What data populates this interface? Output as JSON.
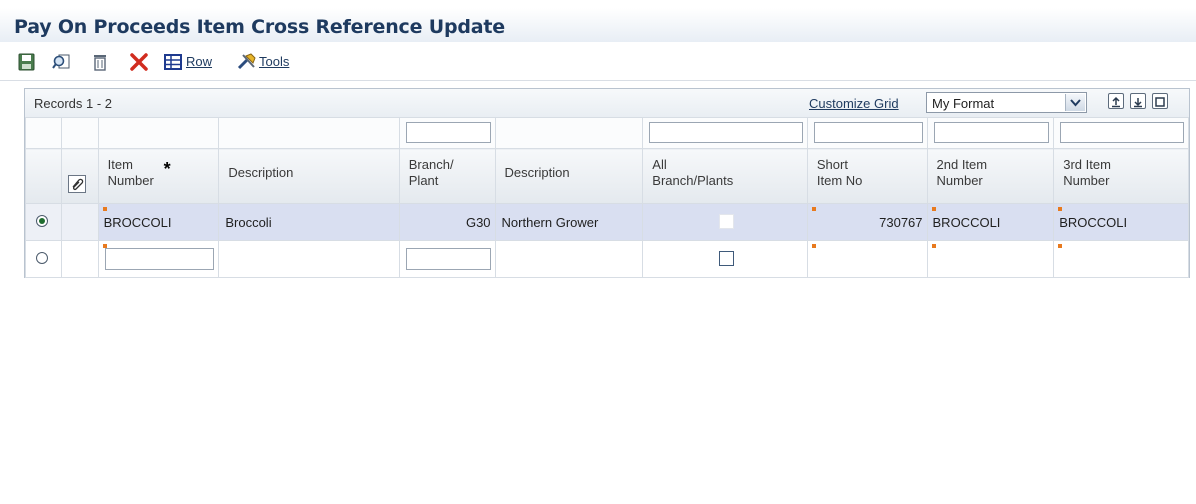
{
  "page": {
    "title": "Pay On Proceeds Item Cross Reference Update"
  },
  "toolbar": {
    "save_icon": "save-icon",
    "inquire_icon": "find-icon",
    "delete_icon": "delete-icon",
    "cancel_icon": "close-icon",
    "row_label": "Row",
    "tools_label": "Tools"
  },
  "grid": {
    "records_label": "Records 1 - 2",
    "customize_label": "Customize Grid",
    "format_value": "My Format",
    "columns": [
      {
        "label": "Item\nNumber",
        "required": "*"
      },
      {
        "label": "Description"
      },
      {
        "label": "Branch/\nPlant"
      },
      {
        "label": "Description"
      },
      {
        "label": "All\nBranch/Plants"
      },
      {
        "label": "Short\nItem No"
      },
      {
        "label": "2nd Item\nNumber"
      },
      {
        "label": "3rd Item\nNumber"
      }
    ],
    "rows": [
      {
        "selected": true,
        "item_number": "BROCCOLI",
        "description": "Broccoli",
        "branch_plant": "G30",
        "branch_description": "Northern Grower",
        "all_branch_plants": false,
        "short_item_no": "730767",
        "item2": "BROCCOLI",
        "item3": "BROCCOLI"
      },
      {
        "selected": false,
        "item_number": "",
        "description": "",
        "branch_plant": "",
        "branch_description": "",
        "all_branch_plants": false,
        "short_item_no": "",
        "item2": "",
        "item3": ""
      }
    ]
  },
  "colors": {
    "title": "#1e3a5f",
    "selected_row": "#d9dff1",
    "marker": "#e87a1e"
  }
}
